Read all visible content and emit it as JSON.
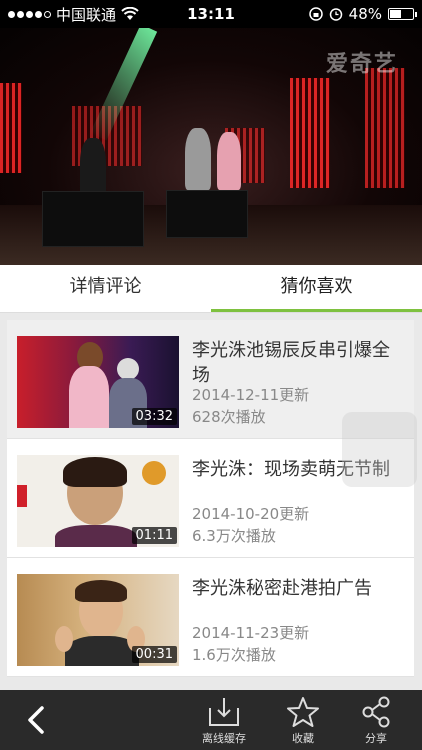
{
  "status_bar": {
    "carrier": "中国联通",
    "time": "13:11",
    "battery_percent": "48%",
    "battery_level": 0.48
  },
  "video": {
    "watermark": "爱奇艺"
  },
  "tabs": [
    {
      "label": "详情评论",
      "active": false
    },
    {
      "label": "猜你喜欢",
      "active": true
    }
  ],
  "items": [
    {
      "title": "李光洙池锡辰反串引爆全场",
      "date": "2014-12-11更新",
      "plays": "628次播放",
      "duration": "03:32"
    },
    {
      "title": "李光洙：现场卖萌无节制",
      "date": "2014-10-20更新",
      "plays": "6.3万次播放",
      "duration": "01:11"
    },
    {
      "title": "李光洙秘密赴港拍广告",
      "date": "2014-11-23更新",
      "plays": "1.6万次播放",
      "duration": "00:31"
    }
  ],
  "toolbar": {
    "offline_label": "离线缓存",
    "favorite_label": "收藏",
    "share_label": "分享"
  },
  "colors": {
    "accent": "#7ec13f",
    "toolbar_bg": "#2a2a2a"
  }
}
